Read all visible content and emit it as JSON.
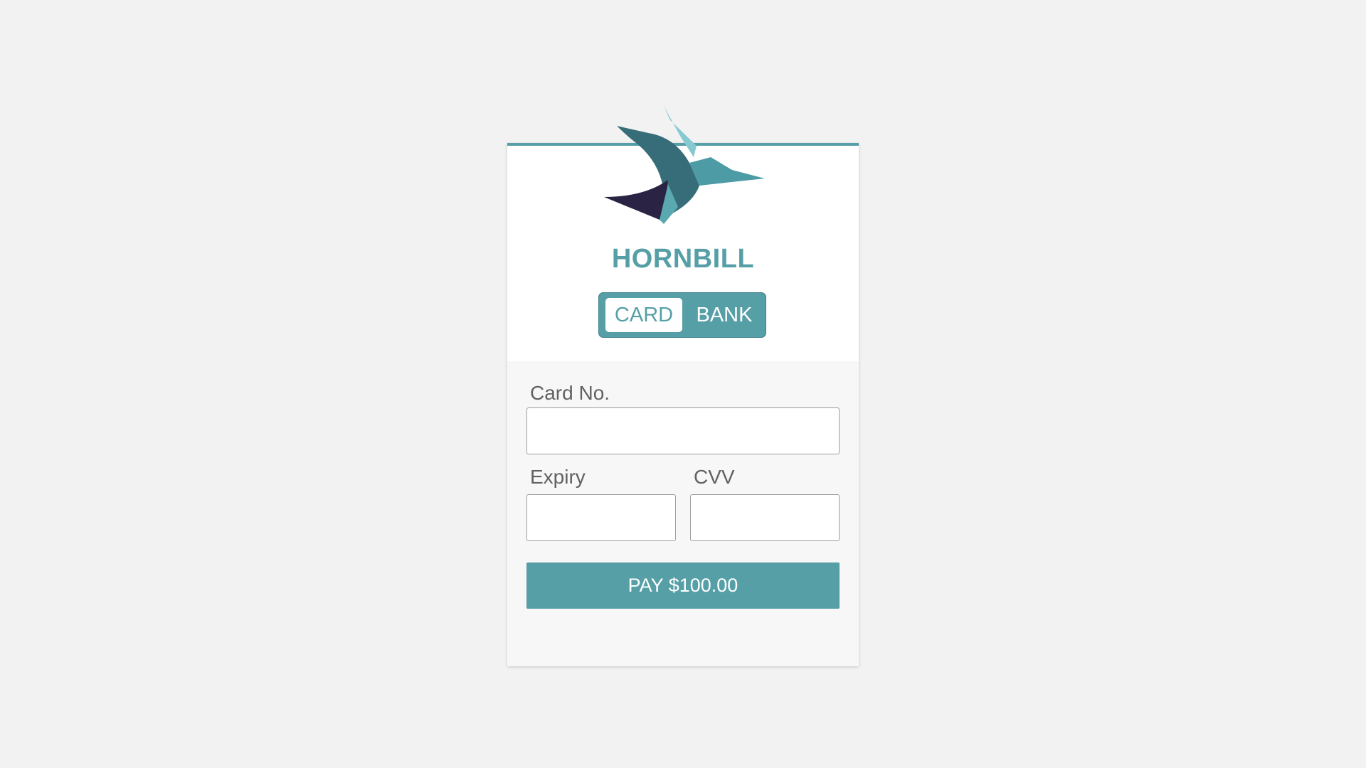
{
  "brand": {
    "name": "HORNBILL",
    "logo_icon": "hornbill-bird-logo",
    "accent_color": "#569fa7"
  },
  "payment_method_toggle": {
    "options": [
      "CARD",
      "BANK"
    ],
    "selected": "CARD"
  },
  "form": {
    "card_number": {
      "label": "Card No.",
      "value": "",
      "placeholder": ""
    },
    "expiry": {
      "label": "Expiry",
      "value": "",
      "placeholder": ""
    },
    "cvv": {
      "label": "CVV",
      "value": "",
      "placeholder": ""
    }
  },
  "pay_button": {
    "label": "PAY $100.00"
  }
}
